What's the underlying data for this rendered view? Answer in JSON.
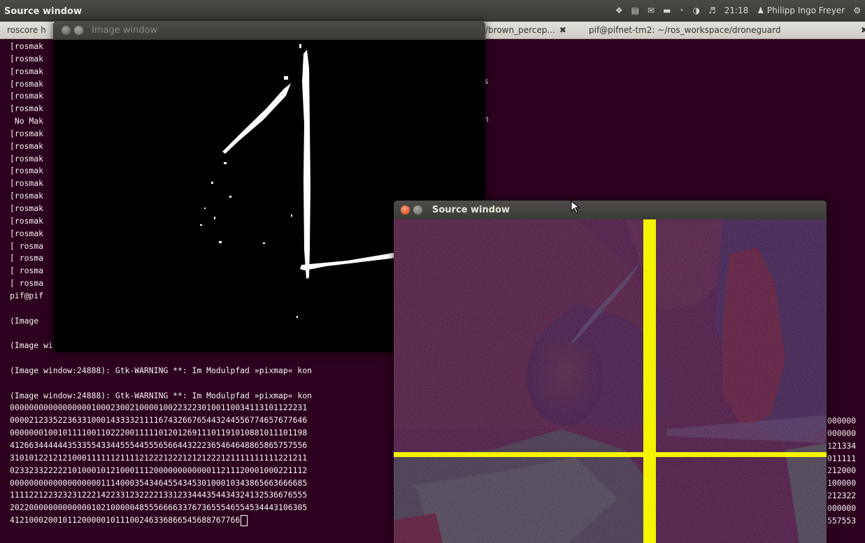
{
  "panel": {
    "title": "Source window",
    "time": "21:18",
    "user": "Philipp Ingo Freyer",
    "icons": [
      "dropbox-icon",
      "notes-icon",
      "mail-icon",
      "battery-icon",
      "bluetooth-icon",
      "wifi-icon",
      "volume-icon",
      "user-icon",
      "power-icon"
    ]
  },
  "tabs": [
    {
      "label": "roscore h"
    },
    {
      "label": "/brown_percep..."
    },
    {
      "label": "pif@pifnet-tm2: ~/ros_workspace/droneguard"
    }
  ],
  "image_window": {
    "title": "Image window"
  },
  "source_window": {
    "title": "Source window"
  },
  "terminal": {
    "lines": [
      "[rosmak",
      "[rosmak",
      "[rosmak",
      "[rosmak",
      "[rosmak",
      "[rosmak",
      " No Mak",
      "[rosmak",
      "[rosmak",
      "[rosmak",
      "[rosmak",
      "[rosmak",
      "[rosmak",
      "[rosmak",
      "[rosmak",
      "[rosmak",
      "[ rosma",
      "[ rosma",
      "[ rosma",
      "[ rosma",
      "pif@pif",
      "",
      "(Image",
      "",
      "(Image window:24888): Gtk-WARNING **: Im Modulpfad »pixmap« kon",
      "",
      "(Image window:24888): Gtk-WARNING **: Im Modulpfad »pixmap« kon",
      "",
      "(Image window:24888): Gtk-WARNING **: Im Modulpfad »pixmap« kon",
      "00000000000000000100023002100001002232230100110034113101122231",
      "00002123352236331000143333211116743266765443244556774657677646",
      "00000001001011110011022200111110120126911101191010881011101198",
      "41266344444435335543344555445556566443222365464648865865757556",
      "31010122121210001111112111121222122212121222121111111111221211",
      "02332332222210100010121000111200000000000011211120001000221112",
      "00000000000000000001114000354346455434530100010343865663666685",
      "11112212232323122214223312322221331233444354434324132536676555",
      "20220000000000000102100000485556666337673655546554534443106305",
      "412100020010112000001011100246336866545688767766"
    ],
    "right_fragments": [
      "000000",
      "000000",
      "121334",
      "011111",
      "212000",
      "100000",
      "212322",
      "000000",
      "557553"
    ],
    "partial_s": "s",
    "partial_n": "n"
  }
}
